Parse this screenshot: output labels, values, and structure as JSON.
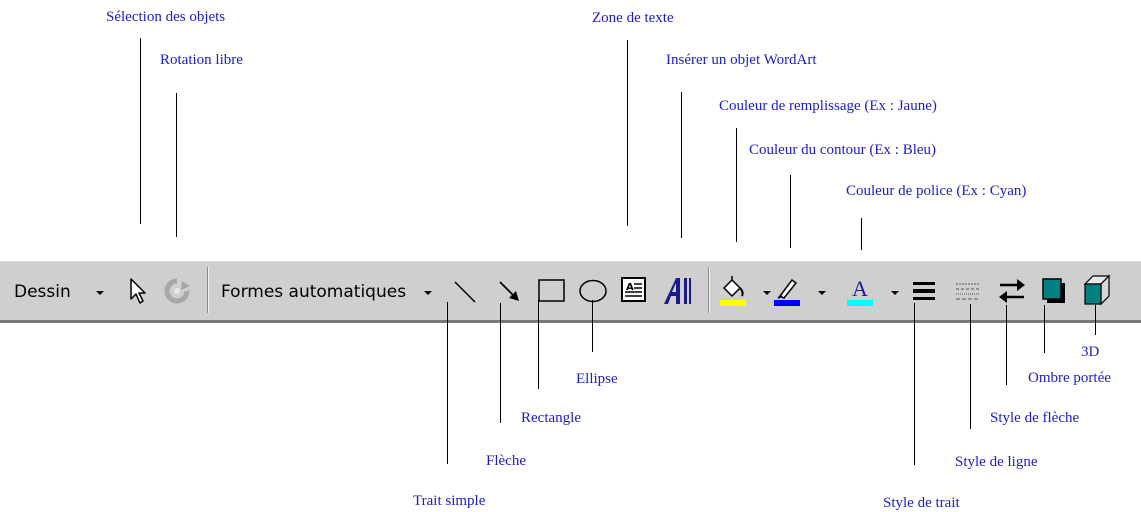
{
  "toolbar": {
    "dessin_label": "Dessin",
    "formes_label": "Formes automatiques",
    "items": [
      "arrow-select",
      "free-rotate",
      "line",
      "arrow",
      "rectangle",
      "ellipse",
      "text-box",
      "wordart",
      "fill-color",
      "line-color",
      "font-color",
      "line-style",
      "dash-style",
      "arrow-style",
      "shadow",
      "3d"
    ],
    "colors": {
      "fill": "#ffff00",
      "line": "#0000ff",
      "font": "#00ffff",
      "shadow": "#008080",
      "box3d": "#008080"
    }
  },
  "callouts": {
    "selection": "Sélection des objets",
    "rotation": "Rotation libre",
    "zone_texte": "Zone de texte",
    "wordart": "Insérer un objet WordArt",
    "remplissage": "Couleur de remplissage (Ex : Jaune)",
    "contour": "Couleur du contour (Ex : Bleu)",
    "police": "Couleur de police (Ex : Cyan)",
    "trait_simple": "Trait simple",
    "fleche": "Flèche",
    "rectangle": "Rectangle",
    "ellipse": "Ellipse",
    "style_trait": "Style de trait",
    "style_ligne": "Style de ligne",
    "style_fleche": "Style de flèche",
    "ombre": "Ombre portée",
    "trois_d": "3D"
  }
}
